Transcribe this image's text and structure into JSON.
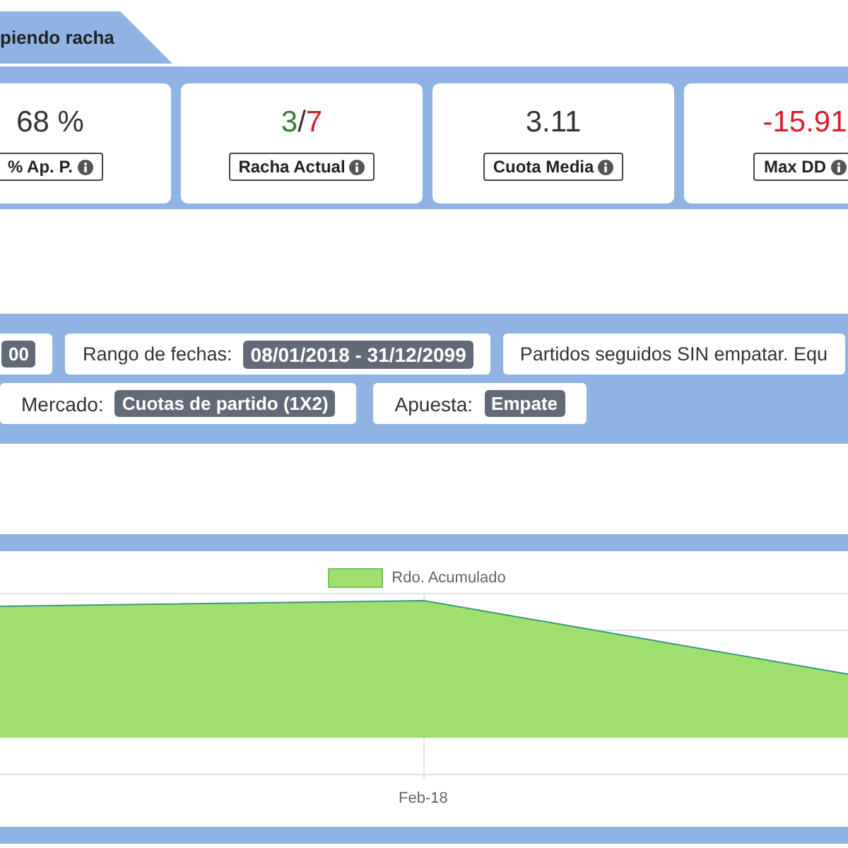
{
  "tab": {
    "label": "piendo racha"
  },
  "stats": [
    {
      "value_parts": [
        {
          "text": "68 %",
          "color": "#333333"
        }
      ],
      "label": "% Ap. P."
    },
    {
      "value_parts": [
        {
          "text": "3",
          "color": "#3c7a3c"
        },
        {
          "text": "/",
          "color": "#333333"
        },
        {
          "text": "7",
          "color": "#d8202a"
        }
      ],
      "label": "Racha Actual"
    },
    {
      "value_parts": [
        {
          "text": "3.11",
          "color": "#333333"
        }
      ],
      "label": "Cuota Media"
    },
    {
      "value_parts": [
        {
          "text": "-15.91",
          "color": "#d8202a"
        }
      ],
      "label": "Max DD"
    }
  ],
  "filter_rows": [
    [
      {
        "badge": "00"
      },
      {
        "label": "Rango de fechas:",
        "badge": "08/01/2018 - 31/12/2099"
      },
      {
        "label": "Partidos seguidos SIN empatar. Equ"
      }
    ],
    [
      {
        "label": "Mercado:",
        "badge": "Cuotas de partido (1X2)"
      },
      {
        "label": "Apuesta:",
        "badge": "Empate"
      }
    ]
  ],
  "chart": {
    "kind": "picture",
    "legend": "Rdo. Acumulado",
    "x_label": "Feb-18"
  }
}
